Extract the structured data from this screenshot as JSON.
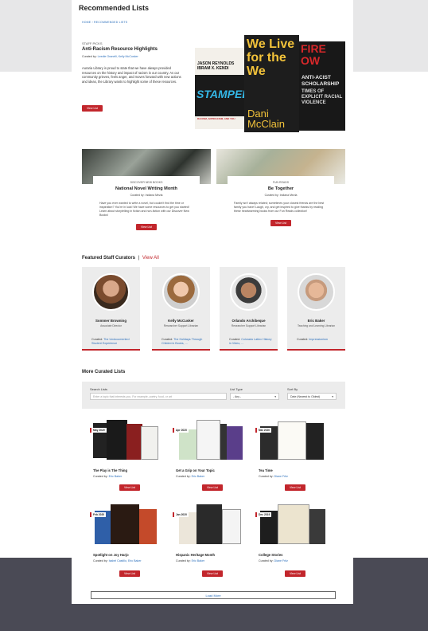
{
  "page": {
    "title": "Recommended Lists",
    "breadcrumbs": [
      "HOME",
      "RECOMMENDED LISTS"
    ]
  },
  "hero": {
    "kicker": "STAFF PICKS",
    "title": "Anti-Racism Resource Highlights",
    "curated_prefix": "Curated by:",
    "curators": "Leedie Granelli, Kelly McCusker",
    "description": "Auraria Library is proud to state that we have always provided resources on the history and impact of racism in our country. As our community grieves, feels anger, and moves forward with new actions and ideas, the Library wants to highlight some of these resources.",
    "button": "View List",
    "books": [
      {
        "title": "STAMPED",
        "authors": "JASON REYNOLDS  IBRAM X. KENDI",
        "subtitle": "RACISM, ANTIRACISM, AND YOU"
      },
      {
        "title": "We Live for the We",
        "author": "Dani McClain"
      },
      {
        "title": "FIRE OW",
        "subtitle": "ANTI-ACIST SCHOLARSHIP",
        "tag": "TIMES OF EXPLICIT RACIAL VIOLENCE"
      }
    ]
  },
  "features": [
    {
      "kicker": "DISCOVER NEW BOOKS",
      "title": "National Novel Writing Month",
      "curated": "Curated by: Indiana Mezla",
      "description": "Have you ever wanted to write a novel, but couldn't find the time or inspiration? You're in luck! We have some resources to get you started! Learn about storytelling in fiction and non-fiction with our Discover New Books!",
      "button": "View List"
    },
    {
      "kicker": "FUN READS",
      "title": "Be Together",
      "curated": "Curated by: Indiana Mezla",
      "description": "Family isn't always related; sometimes your closest friends are the best family you have! Laugh, cry, and get inspired to give thanks by reading these heartwarming books from our Fun Reads collection!",
      "button": "View List"
    }
  ],
  "curators_section": {
    "title": "Featured Staff Curators",
    "separator": "|",
    "view_all": "View All",
    "curated_prefix": "Curated:",
    "curators": [
      {
        "name": "Sommer Browning",
        "role": "Associate Director",
        "list": "The Undocumented Student Experience"
      },
      {
        "name": "Kelly McCusker",
        "role": "Researcher Support Librarian",
        "list": "The Holidays Through Children's Books, ..."
      },
      {
        "name": "Orlando Archibeque",
        "role": "Researcher Support Librarian",
        "list": "Colorado Latinx History in Video, ..."
      },
      {
        "name": "Eric Baker",
        "role": "Teaching and Learning Librarian",
        "list": "Impressionism"
      }
    ]
  },
  "more_lists": {
    "title": "More Curated Lists",
    "search": {
      "label": "Search Lists",
      "placeholder": "Enter a topic that interests you. For example, poetry, food, or art",
      "type_label": "List Type",
      "type_value": "- Any -",
      "sort_label": "Sort By",
      "sort_value": "Date (Newest to Oldest)"
    },
    "curated_prefix": "Curated by:",
    "button": "View List",
    "lists": [
      {
        "title": "The Play is The Thing",
        "curator": "Eric Baker",
        "date": "May 2020"
      },
      {
        "title": "Get a Grip on Your Topic",
        "curator": "Eric Baker",
        "date": "Apr 2020"
      },
      {
        "title": "Tea Time",
        "curator": "Diane Fritz",
        "date": "Mar 2020"
      },
      {
        "title": "Spotlight on Joy Harjo",
        "curator": "Isabel Castillo, Eric Baker",
        "date": "Feb 2020"
      },
      {
        "title": "Hispanic Heritage Month",
        "curator": "Eric Baker",
        "date": "Jan 2020"
      },
      {
        "title": "College Stories",
        "curator": "Diane Fritz",
        "date": "Dec 2019"
      }
    ],
    "load_more": "Load More"
  },
  "colors": {
    "accent": "#c2262c",
    "link": "#2a6ebb",
    "panel": "#ececec",
    "footer": "#4a4a55"
  }
}
